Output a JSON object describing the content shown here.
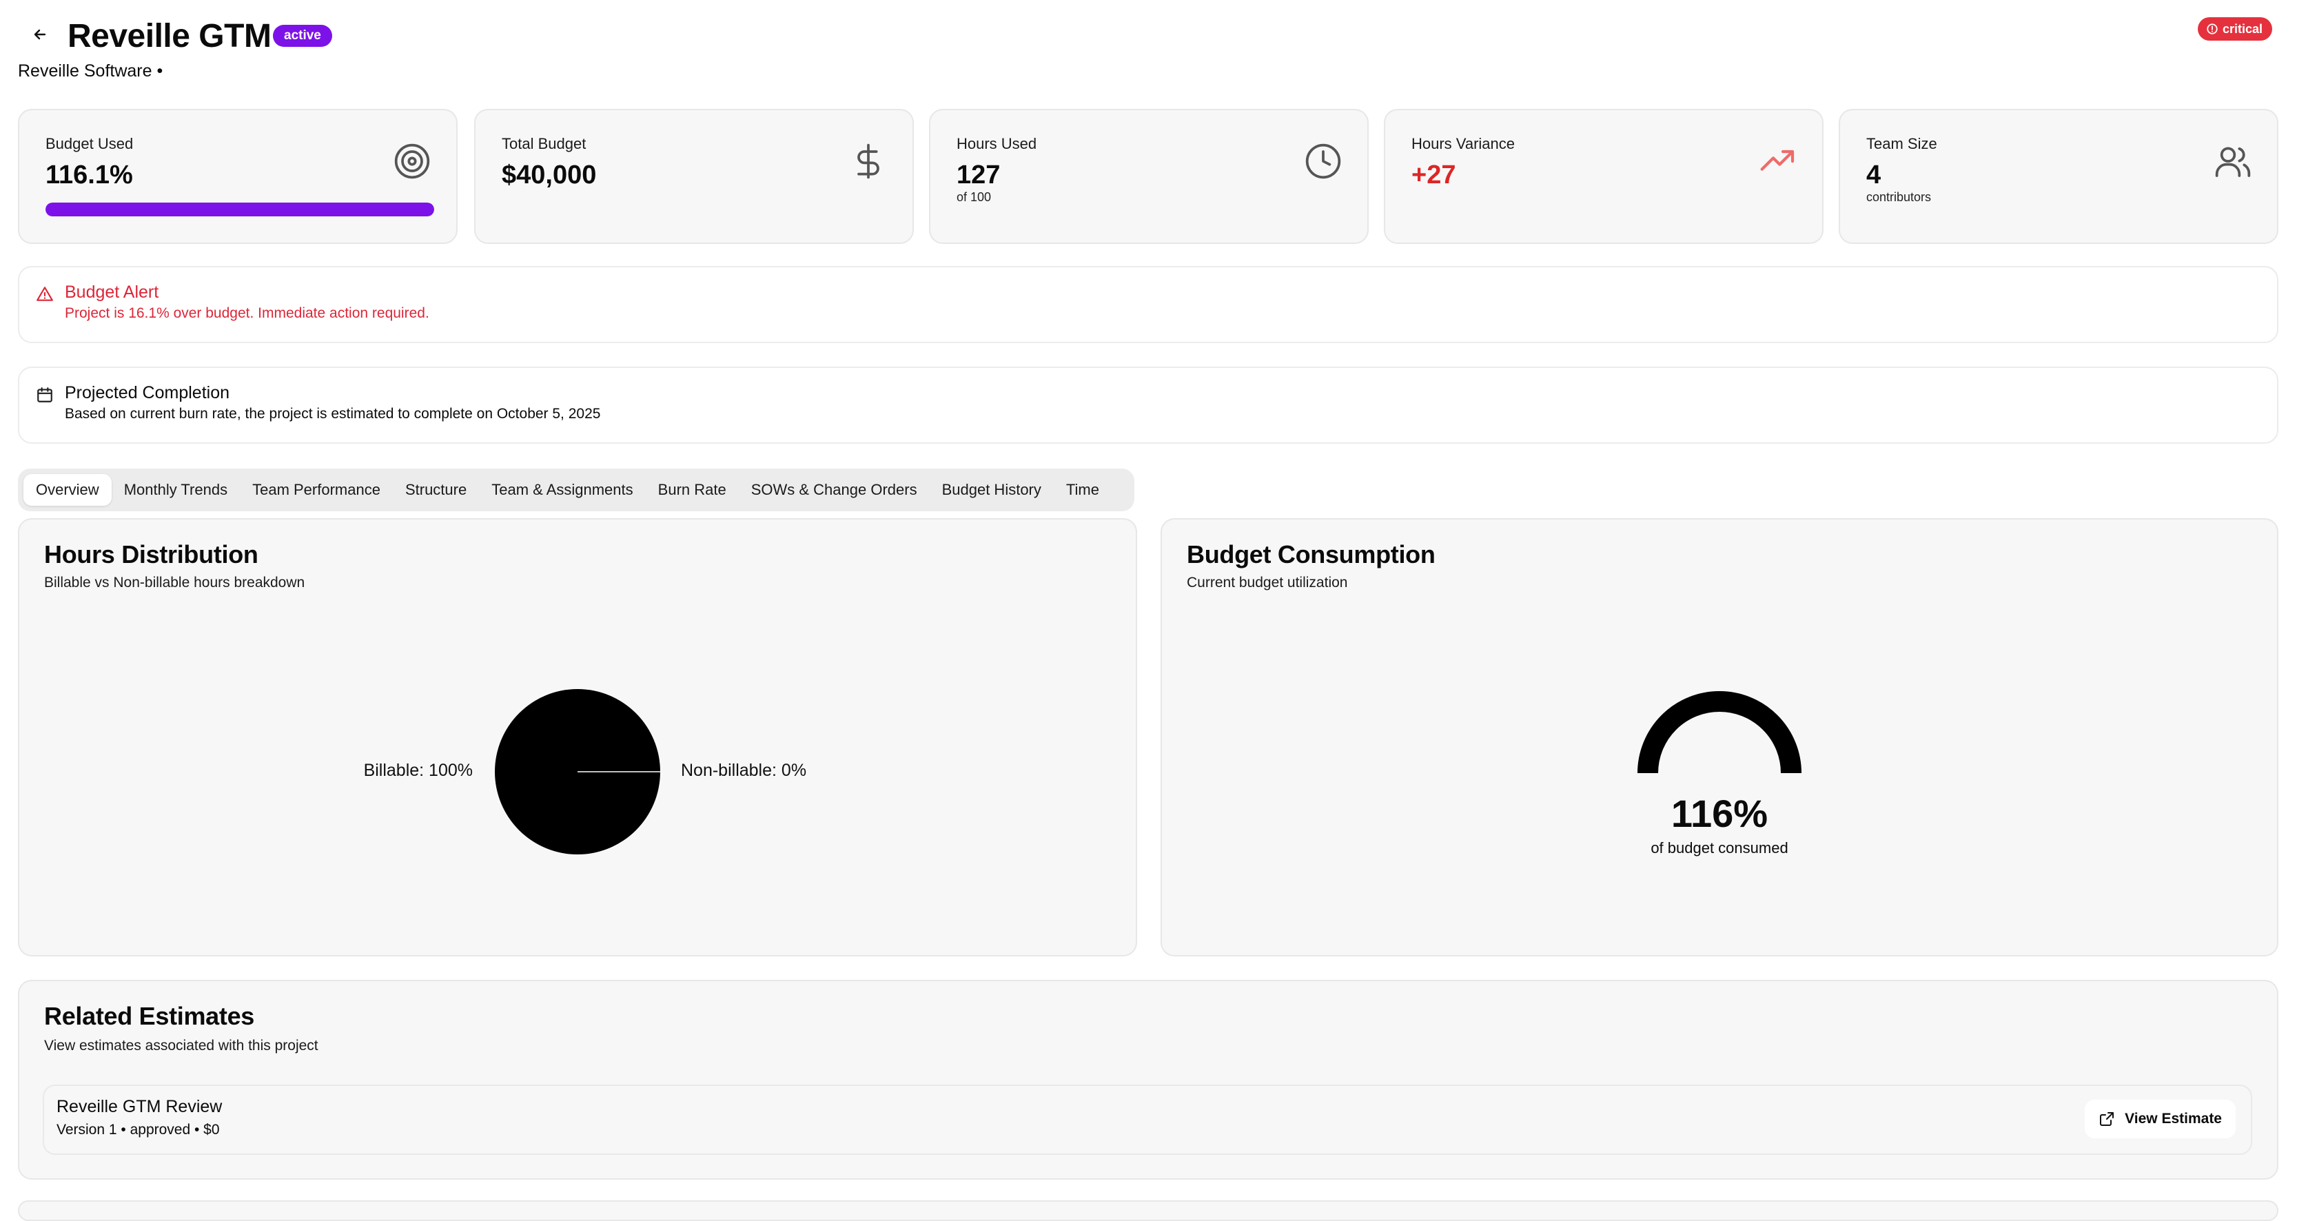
{
  "header": {
    "title": "Reveille GTM",
    "status_badge": "active",
    "company": "Reveille Software •",
    "priority_badge": "critical"
  },
  "stats": [
    {
      "label": "Budget Used",
      "value": "116.1%",
      "icon": "target-icon",
      "progress_percent": 100
    },
    {
      "label": "Total Budget",
      "value": "$40,000",
      "icon": "dollar-icon"
    },
    {
      "label": "Hours Used",
      "value": "127",
      "sub": "of 100",
      "icon": "clock-icon"
    },
    {
      "label": "Hours Variance",
      "value": "+27",
      "icon": "trending-up-icon"
    },
    {
      "label": "Team Size",
      "value": "4",
      "sub": "contributors",
      "icon": "users-icon"
    }
  ],
  "budget_alert": {
    "title": "Budget Alert",
    "message": "Project is 16.1% over budget. Immediate action required."
  },
  "projected_completion": {
    "title": "Projected Completion",
    "message": "Based on current burn rate, the project is estimated to complete on October 5, 2025"
  },
  "tabs": [
    {
      "label": "Overview",
      "active": true
    },
    {
      "label": "Monthly Trends"
    },
    {
      "label": "Team Performance"
    },
    {
      "label": "Structure"
    },
    {
      "label": "Team & Assignments"
    },
    {
      "label": "Burn Rate"
    },
    {
      "label": "SOWs & Change Orders"
    },
    {
      "label": "Budget History"
    },
    {
      "label": "Time"
    }
  ],
  "hours_distribution": {
    "title": "Hours Distribution",
    "subtitle": "Billable vs Non-billable hours breakdown",
    "label_billable": "Billable: 100%",
    "label_nonbillable": "Non-billable: 0%"
  },
  "budget_consumption": {
    "title": "Budget Consumption",
    "subtitle": "Current budget utilization",
    "value": "116%",
    "caption": "of budget consumed"
  },
  "related_estimates": {
    "title": "Related Estimates",
    "subtitle": "View estimates associated with this project",
    "items": [
      {
        "name": "Reveille GTM Review",
        "meta": "Version 1 • approved • $0",
        "button": "View Estimate"
      }
    ]
  },
  "colors": {
    "accent": "#7c12e8",
    "danger": "#e5313d",
    "alert_text": "#dc2638",
    "variance": "#dc2626"
  },
  "chart_data": [
    {
      "type": "pie",
      "categories": [
        "Billable",
        "Non-billable"
      ],
      "values": [
        100,
        0
      ]
    },
    {
      "type": "gauge",
      "value": 116,
      "range": [
        0,
        100
      ]
    }
  ]
}
